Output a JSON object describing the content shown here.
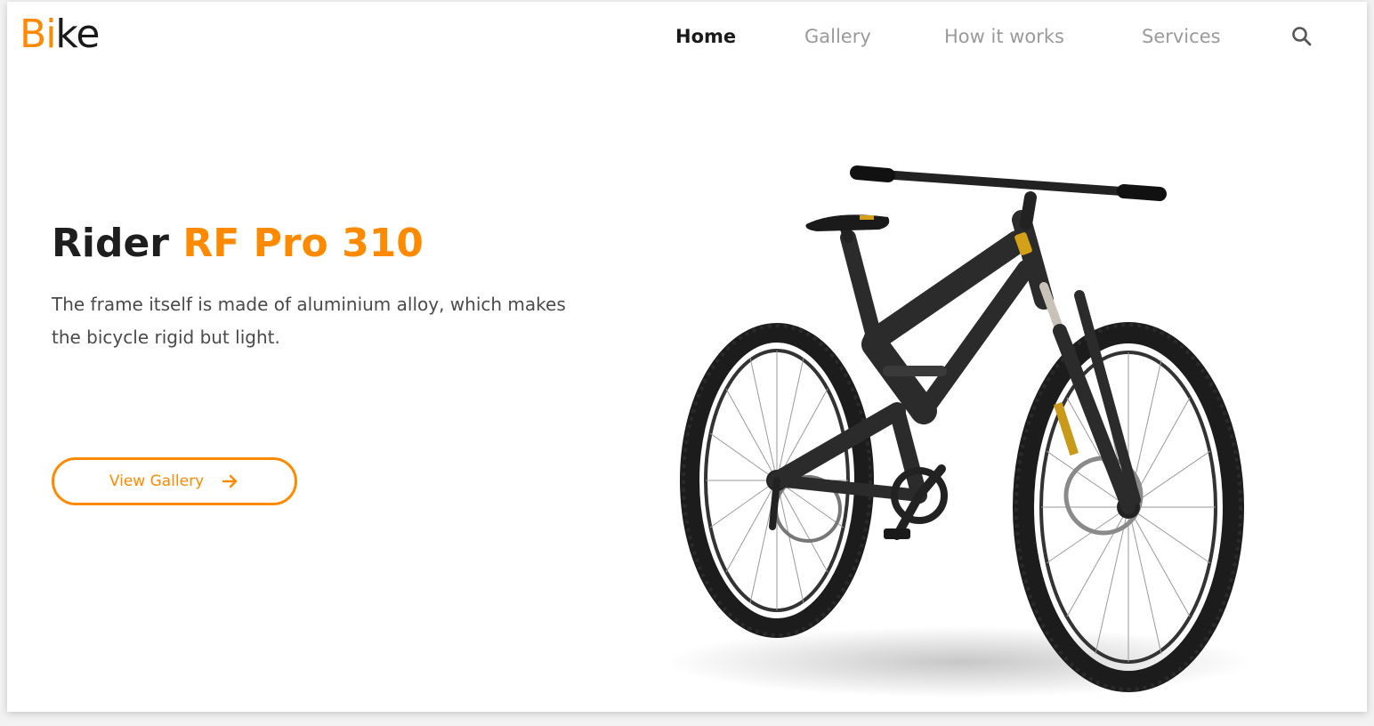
{
  "brand": {
    "logo_accent": "B",
    "logo_accent_2": "i",
    "logo_rest": "ke"
  },
  "nav": {
    "items": [
      {
        "label": "Home",
        "active": true
      },
      {
        "label": "Gallery"
      },
      {
        "label": "How it works"
      },
      {
        "label": "Services"
      }
    ],
    "search_icon": "search-icon"
  },
  "hero": {
    "title_main": "Rider ",
    "title_accent": "RF Pro 310",
    "description": "The frame itself is made of aluminium alloy, which makes the bicycle rigid but light.",
    "cta_label": "View Gallery",
    "cta_icon": "arrow-right-icon",
    "image": "mountain-bike-image"
  },
  "colors": {
    "accent": "#ff8a00",
    "text": "#1e1e1e",
    "muted": "#9a9a9a"
  }
}
